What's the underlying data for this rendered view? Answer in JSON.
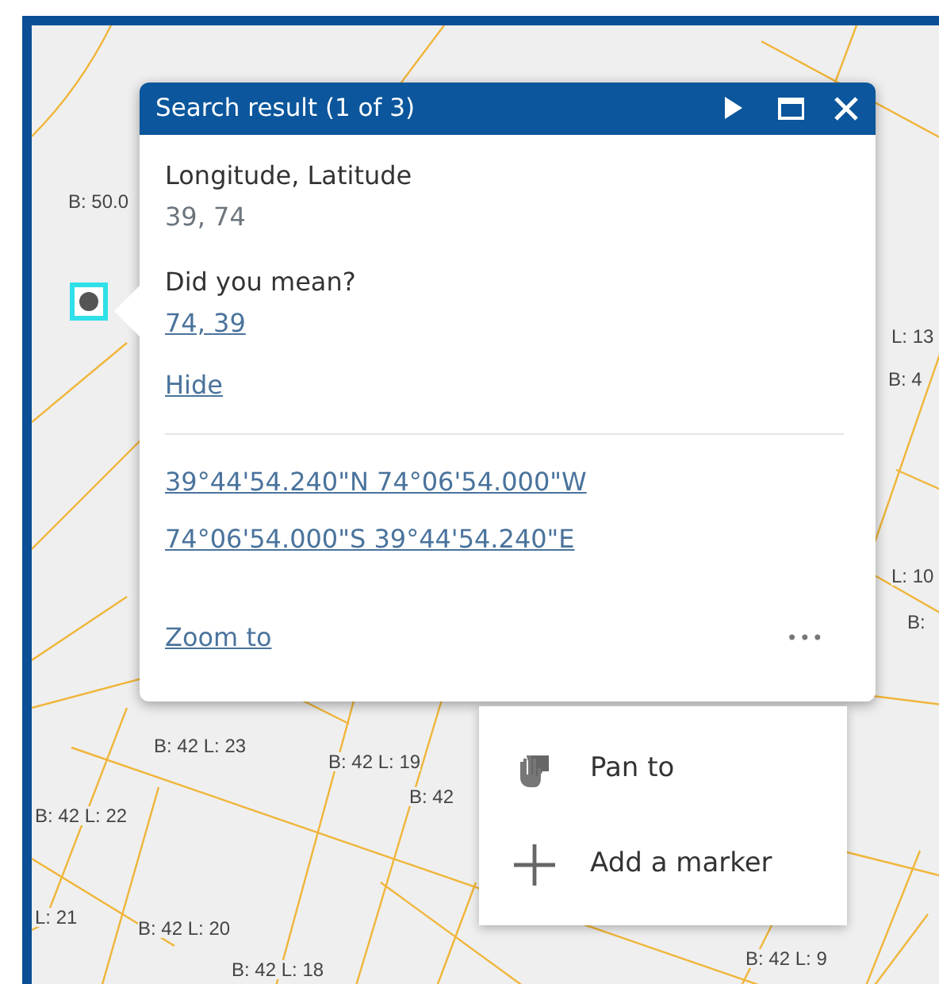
{
  "map_labels": [
    "B: 50.0",
    "L: 13",
    "B: 4",
    "L: 10",
    "B:",
    "B: 42 L: 23",
    "B: 42 L: 19",
    "B: 42",
    "B: 42 L: 22",
    "L: 21",
    "B: 42 L: 20",
    "B: 42 L: 18",
    "B: 42 L: 9"
  ],
  "popup": {
    "title": "Search result (1 of 3)",
    "heading": "Longitude, Latitude",
    "value": "39, 74",
    "suggest_label": "Did you mean?",
    "suggestion": "74, 39",
    "hide": "Hide",
    "coordinates": [
      "39°44'54.240\"N 74°06'54.000\"W",
      "74°06'54.000\"S 39°44'54.240\"E"
    ],
    "zoom_to": "Zoom to",
    "more": "•••"
  },
  "menu": [
    {
      "kind": "pan",
      "label": "Pan to"
    },
    {
      "kind": "add",
      "label": "Add a marker"
    }
  ]
}
